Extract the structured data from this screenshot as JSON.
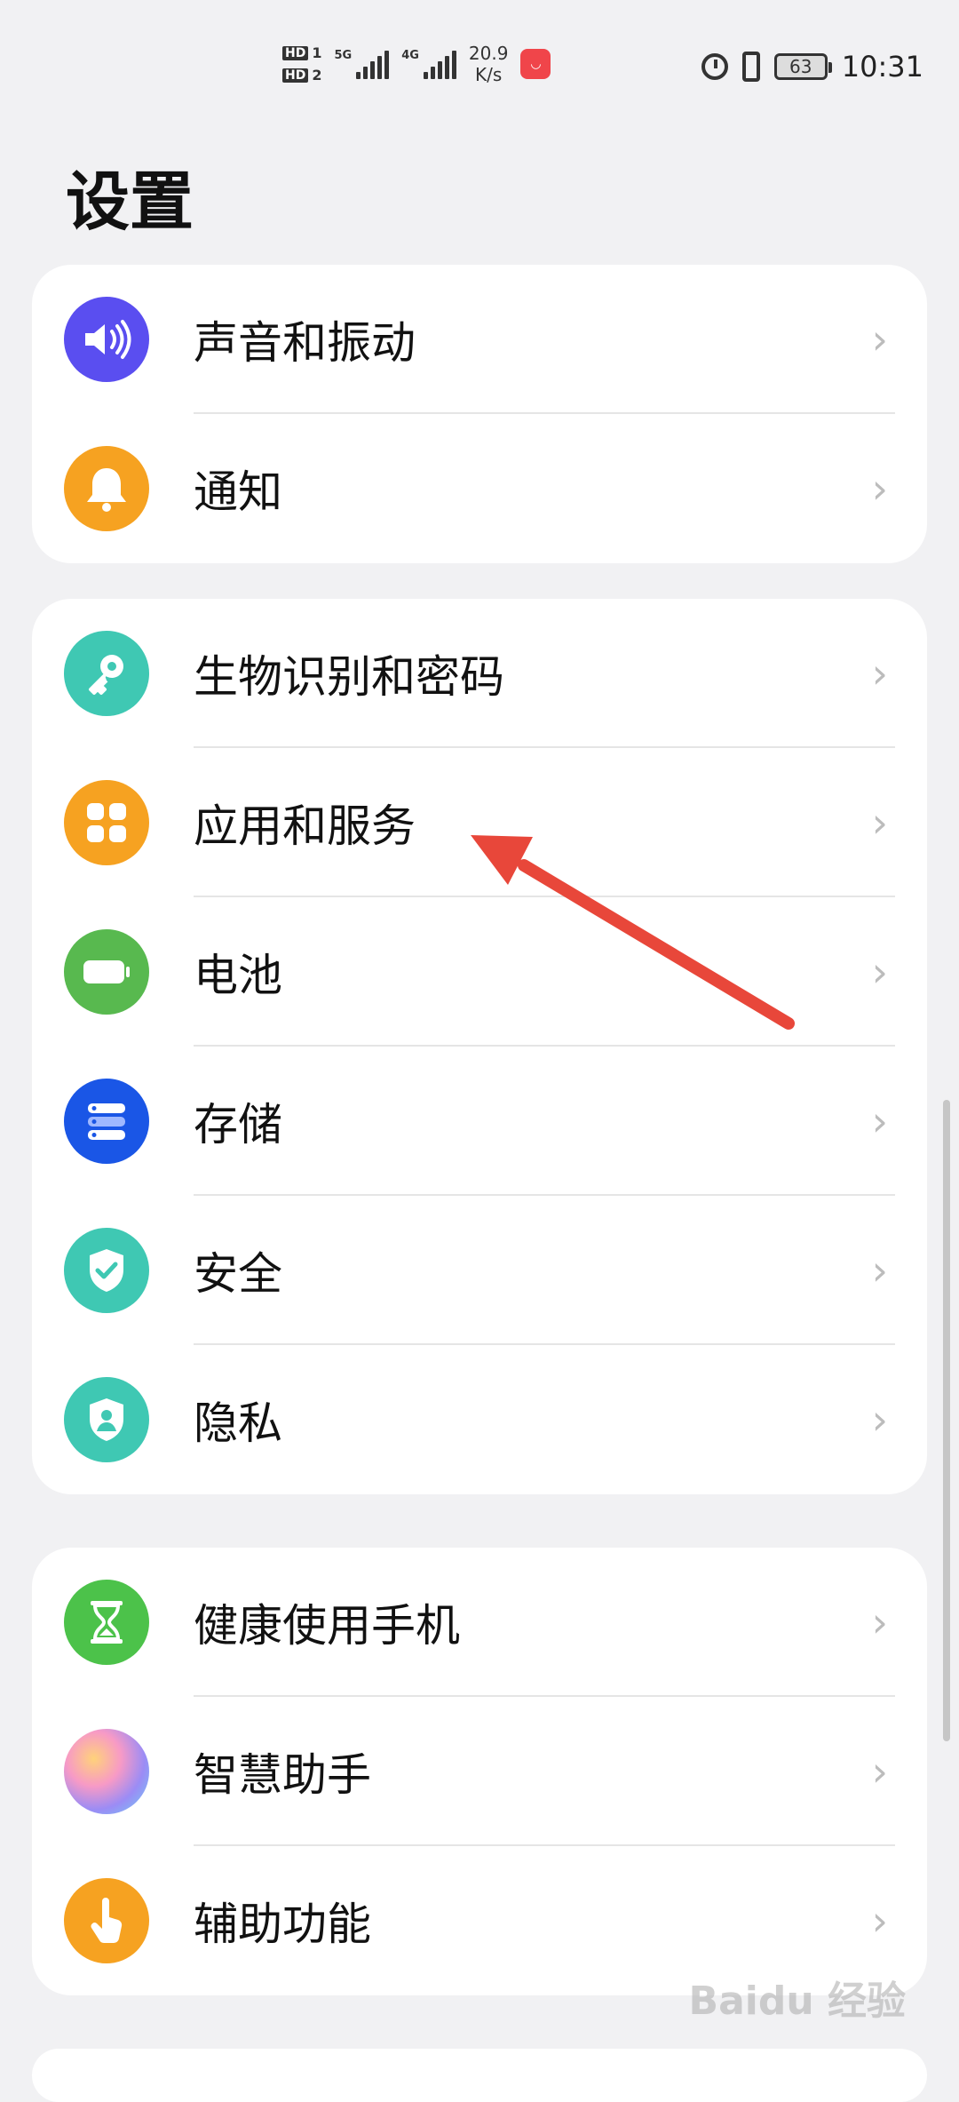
{
  "status_bar": {
    "hd1": "HD",
    "hd1_num": "1",
    "hd2": "HD",
    "hd2_num": "2",
    "net1": "5G",
    "net2": "4G",
    "speed_value": "20.9",
    "speed_unit": "K/s",
    "battery": "63",
    "time": "10:31"
  },
  "title": "设置",
  "groups": [
    {
      "items": [
        {
          "label": "声音和振动",
          "icon": "speaker-icon",
          "color": "#5a4ef0"
        },
        {
          "label": "通知",
          "icon": "bell-icon",
          "color": "#f6a221"
        }
      ]
    },
    {
      "items": [
        {
          "label": "生物识别和密码",
          "icon": "key-icon",
          "color": "#3fc8b3"
        },
        {
          "label": "应用和服务",
          "icon": "apps-icon",
          "color": "#f6a221"
        },
        {
          "label": "电池",
          "icon": "battery-icon",
          "color": "#58b94f"
        },
        {
          "label": "存储",
          "icon": "storage-icon",
          "color": "#1a56e6"
        },
        {
          "label": "安全",
          "icon": "shield-check-icon",
          "color": "#3fc8b3"
        },
        {
          "label": "隐私",
          "icon": "privacy-shield-icon",
          "color": "#3fc8b3"
        }
      ]
    },
    {
      "items": [
        {
          "label": "健康使用手机",
          "icon": "hourglass-icon",
          "color": "#4cc24a"
        },
        {
          "label": "智慧助手",
          "icon": "assistant-icon",
          "color": "#f3a0c8"
        },
        {
          "label": "辅助功能",
          "icon": "hand-icon",
          "color": "#f6a221"
        }
      ]
    }
  ],
  "chevron": "›",
  "watermark": "Baidu 经验"
}
